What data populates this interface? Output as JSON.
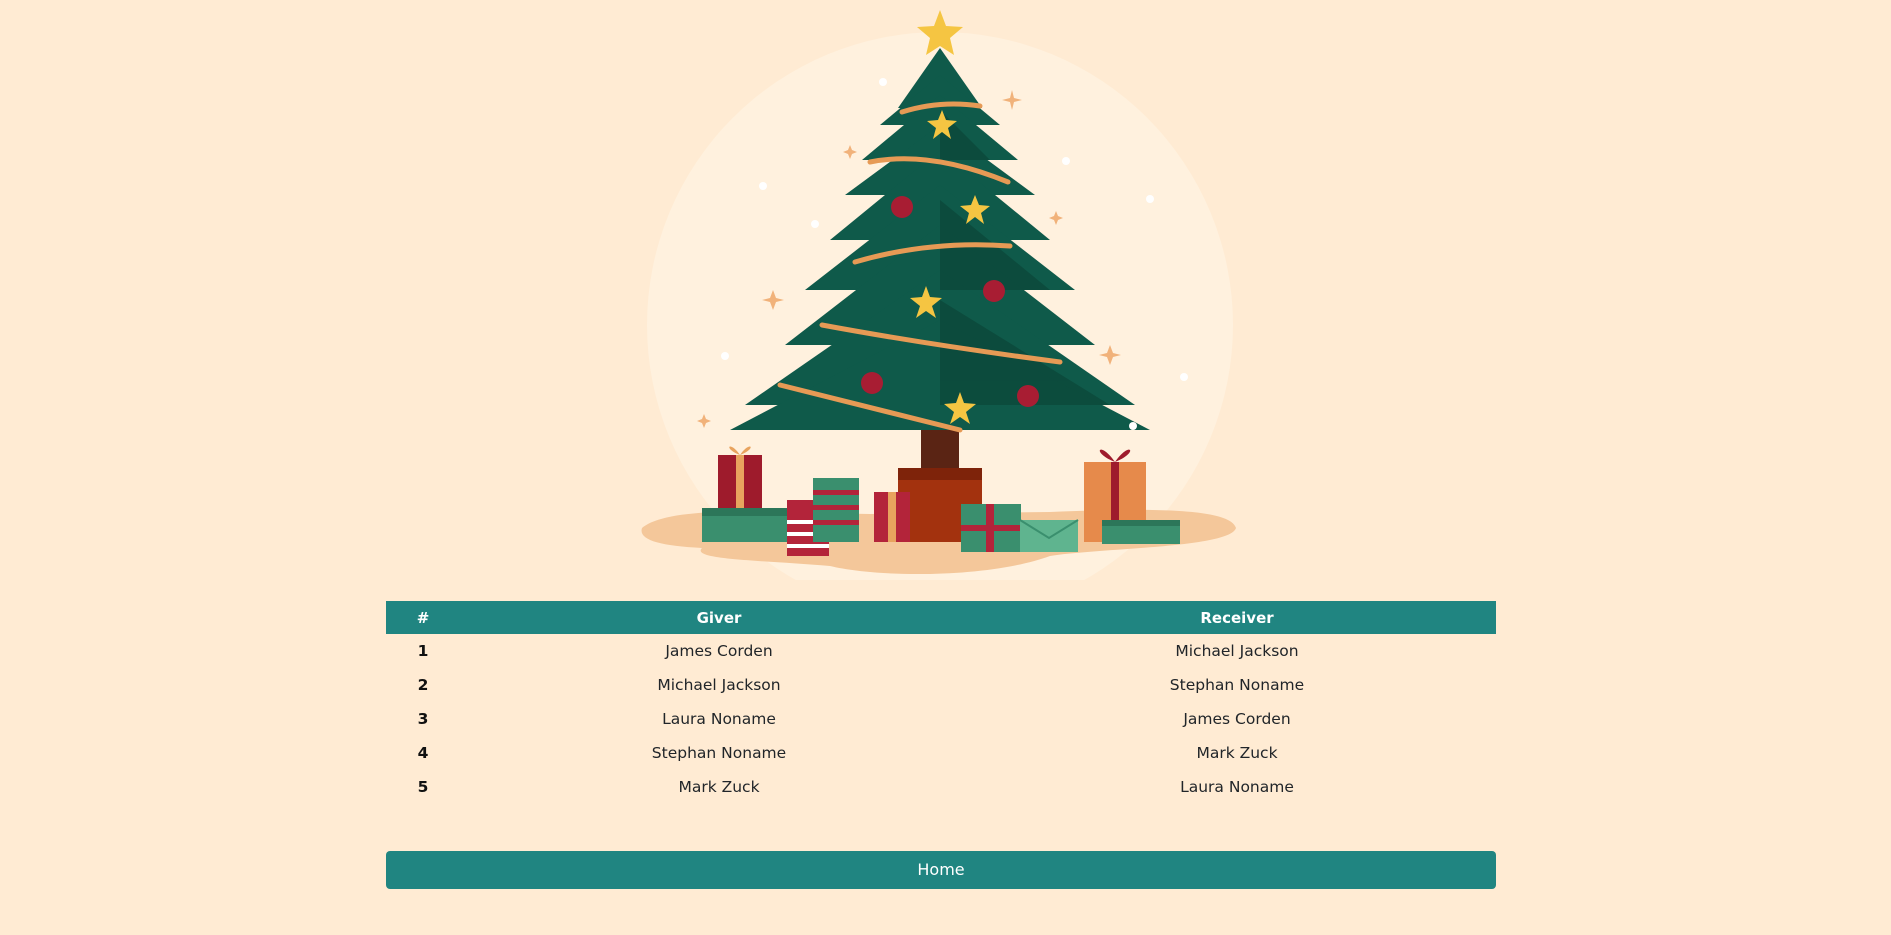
{
  "table": {
    "headers": {
      "index": "#",
      "giver": "Giver",
      "receiver": "Receiver"
    },
    "rows": [
      {
        "index": "1",
        "giver": "James Corden",
        "receiver": "Michael Jackson"
      },
      {
        "index": "2",
        "giver": "Michael Jackson",
        "receiver": "Stephan Noname"
      },
      {
        "index": "3",
        "giver": "Laura Noname",
        "receiver": "James Corden"
      },
      {
        "index": "4",
        "giver": "Stephan Noname",
        "receiver": "Mark Zuck"
      },
      {
        "index": "5",
        "giver": "Mark Zuck",
        "receiver": "Laura Noname"
      }
    ]
  },
  "home_button": {
    "label": "Home"
  },
  "illustration": {
    "icon": "christmas-tree-illustration"
  },
  "colors": {
    "background": "#ffebd3",
    "accent": "#208581",
    "tree": "#0f5a4a",
    "star": "#f5c542",
    "gift_red": "#9e1b2c",
    "gift_green": "#3a8f6e",
    "gift_orange": "#e68a4b"
  }
}
